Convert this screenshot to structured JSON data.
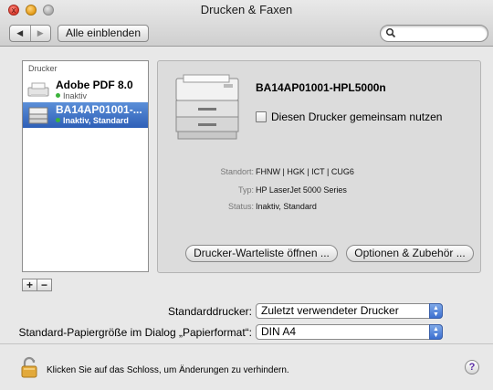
{
  "window": {
    "title": "Drucken & Faxen",
    "close_glyph": "x"
  },
  "toolbar": {
    "back_icon": "back-arrow",
    "forward_icon": "forward-arrow",
    "show_all_label": "Alle einblenden",
    "search_value": "",
    "search_placeholder": ""
  },
  "sidebar": {
    "header": "Drucker",
    "printers": [
      {
        "name": "Adobe PDF 8.0",
        "status": "Inaktiv",
        "selected": false
      },
      {
        "name": "BA14AP01001-...",
        "status": "Inaktiv, Standard",
        "selected": true
      }
    ],
    "add_label": "+",
    "remove_label": "−"
  },
  "detail": {
    "printer_name": "BA14AP01001-HPL5000n",
    "share_label": "Diesen Drucker gemeinsam nutzen",
    "share_checked": false,
    "location_label": "Standort:",
    "location_value": "FHNW | HGK | ICT | CUG6",
    "type_label": "Typ:",
    "type_value": "HP LaserJet 5000 Series",
    "status_label": "Status:",
    "status_value": "Inaktiv, Standard",
    "queue_button": "Drucker-Warteliste öffnen ...",
    "options_button": "Optionen & Zubehör ..."
  },
  "settings": {
    "default_printer_label": "Standarddrucker:",
    "default_printer_value": "Zuletzt verwendeter Drucker",
    "paper_size_label": "Standard-Papiergröße im Dialog „Papierformat“:",
    "paper_size_value": "DIN A4"
  },
  "footer": {
    "lock_text": "Klicken Sie auf das Schloss, um Änderungen zu verhindern.",
    "help_label": "?"
  },
  "colors": {
    "selection": "#2e5fb7",
    "status_dot": "#3bb33b",
    "select_arrows": "#3c6fd0"
  }
}
